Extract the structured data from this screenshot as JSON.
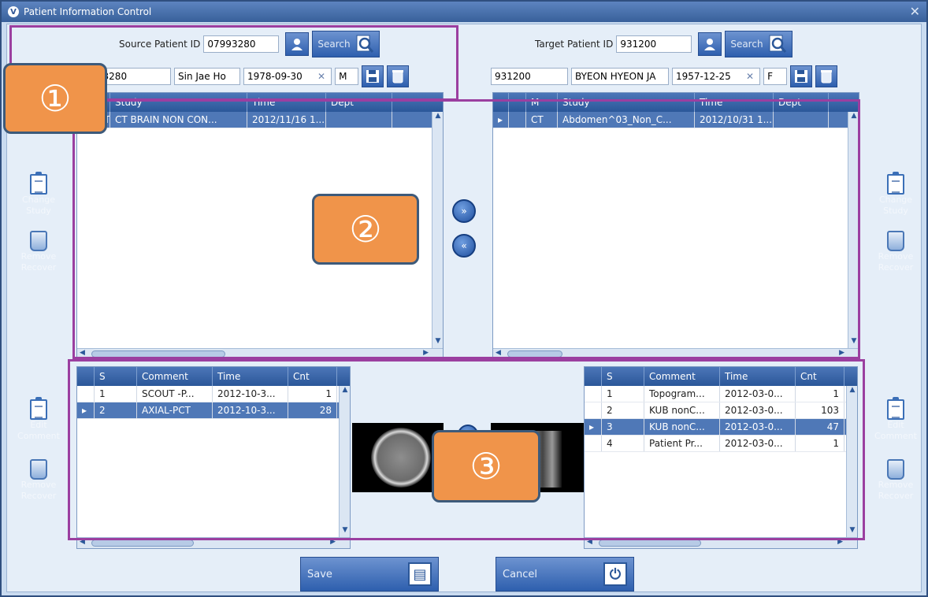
{
  "window": {
    "title": "Patient Information Control",
    "close_glyph": "✕",
    "logo_glyph": "V"
  },
  "source": {
    "label": "Source Patient ID",
    "patient_id_value": "07993280",
    "search_label": "Search",
    "info": {
      "id": "07993280",
      "name": "Sin Jae Ho",
      "birth": "1978-09-30",
      "sex": "M"
    },
    "study_columns": [
      "M",
      "Study",
      "Time",
      "Dept"
    ],
    "studies": [
      {
        "modality": "CT",
        "study": "CT BRAIN NON CON...",
        "time": "2012/11/16 1...",
        "dept": "",
        "selected": true
      }
    ],
    "series_columns": [
      "S",
      "Comment",
      "Time",
      "Cnt"
    ],
    "series": [
      {
        "s": "1",
        "comment": "SCOUT -P...",
        "time": "2012-10-3...",
        "cnt": "1",
        "selected": false
      },
      {
        "s": "2",
        "comment": "AXIAL-PCT",
        "time": "2012-10-3...",
        "cnt": "28",
        "selected": true
      }
    ]
  },
  "target": {
    "label": "Target Patient ID",
    "patient_id_value": "931200",
    "search_label": "Search",
    "info": {
      "id": "931200",
      "name": "BYEON HYEON JA",
      "birth": "1957-12-25",
      "sex": "F"
    },
    "study_columns": [
      "M",
      "Study",
      "Time",
      "Dept"
    ],
    "studies": [
      {
        "modality": "CT",
        "study": "Abdomen^03_Non_C...",
        "time": "2012/10/31 1...",
        "dept": "",
        "selected": true
      }
    ],
    "series_columns": [
      "S",
      "Comment",
      "Time",
      "Cnt"
    ],
    "series": [
      {
        "s": "1",
        "comment": "Topogram...",
        "time": "2012-03-0...",
        "cnt": "1",
        "selected": false
      },
      {
        "s": "2",
        "comment": "KUB nonC...",
        "time": "2012-03-0...",
        "cnt": "103",
        "selected": false
      },
      {
        "s": "3",
        "comment": "KUB nonC...",
        "time": "2012-03-0...",
        "cnt": "47",
        "selected": true
      },
      {
        "s": "4",
        "comment": "Patient Pr...",
        "time": "2012-03-0...",
        "cnt": "1",
        "selected": false
      }
    ]
  },
  "side_tools": {
    "change_study": "Change Study",
    "remove_recover": "Remove Recover",
    "edit_comment": "Edit Comment"
  },
  "transfer": {
    "move_right": "»",
    "move_left": "«"
  },
  "buttons": {
    "save": "Save",
    "cancel": "Cancel"
  },
  "annotations": [
    "①",
    "②",
    "③"
  ],
  "colors": {
    "accent": "#2e5fae",
    "annotation_box": "#9b3fa0",
    "annotation_badge": "#f0944a",
    "selected_row": "#4f78b7"
  }
}
